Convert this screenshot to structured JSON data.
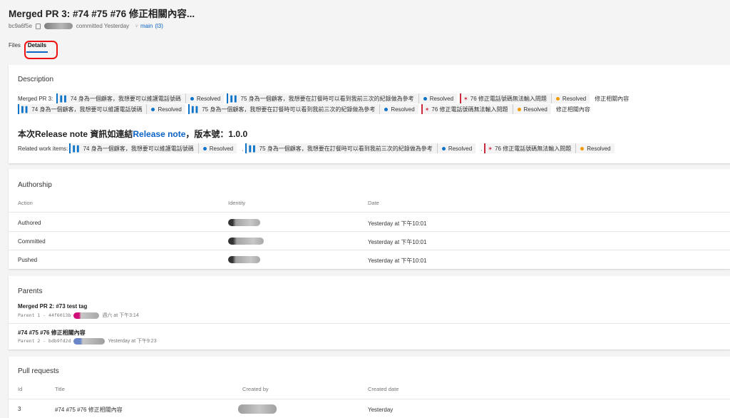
{
  "header": {
    "title": "Merged PR 3: #74 #75 #76 修正相關內容...",
    "commit_hash": "bc9a6f5e",
    "committed_text": "committed Yesterday",
    "branch_label": "main",
    "branch_count": "(l3)"
  },
  "tabs": {
    "files": "Files",
    "details": "Details"
  },
  "description": {
    "heading": "Description",
    "line1_prefix": "Merged PR 3:",
    "wi_74_num": "74",
    "wi_74_title": "身為一個顧客，我想要可以維護電話號碼",
    "wi_75_num": "75",
    "wi_75_title": "身為一個顧客，我想要在訂餐時可以看到我前三次的紀錄做為參考",
    "wi_76_num": "76",
    "wi_76_title": "修正電話號碼無法輸入問題",
    "state_resolved": "Resolved",
    "trailing_text": "修正相關內容",
    "release_prefix": "本次Release note 資訊如連結",
    "release_link": "Release note",
    "release_suffix": "，版本號：1.0.0",
    "related_label": "Related work items:",
    "comma": ","
  },
  "authorship": {
    "heading": "Authorship",
    "columns": [
      "Action",
      "Identity",
      "Date"
    ],
    "rows": [
      {
        "action": "Authored",
        "date": "Yesterday at 下午10:01"
      },
      {
        "action": "Committed",
        "date": "Yesterday at 下午10:01"
      },
      {
        "action": "Pushed",
        "date": "Yesterday at 下午10:01"
      }
    ]
  },
  "parents": {
    "heading": "Parents",
    "items": [
      {
        "title": "Merged PR 2: #73 test tag",
        "ref": "Parent 1 - 44f6013b",
        "date": "週六 at 下午3:14"
      },
      {
        "title": "#74 #75 #76 修正相關內容",
        "ref": "Parent 2 - bdb9fd2d",
        "date": "Yesterday at 下午9:23"
      }
    ]
  },
  "pull_requests": {
    "heading": "Pull requests",
    "columns": [
      "Id",
      "Title",
      "Created by",
      "Created date"
    ],
    "rows": [
      {
        "id": "3",
        "title": "#74 #75 #76 修正相關內容",
        "created_date": "Yesterday"
      }
    ]
  },
  "icons": {
    "book": "book-icon",
    "bug": "bug-icon",
    "copy": "copy-icon",
    "branch": "branch-icon"
  },
  "colors": {
    "accent": "#0b63c6",
    "story": "#0b73c8",
    "bug": "#cc293d",
    "resolved_orange": "#f29b00"
  }
}
